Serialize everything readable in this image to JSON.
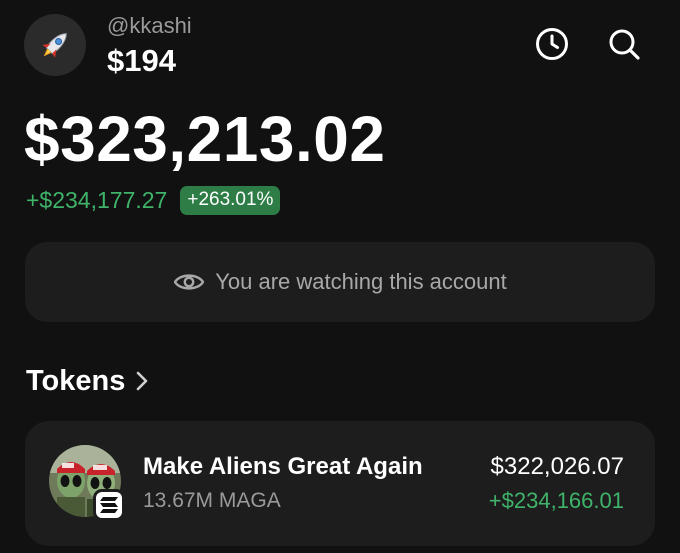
{
  "profile": {
    "avatar_icon": "rocket-icon",
    "username": "@kkashi",
    "small_balance": "$194"
  },
  "header_actions": {
    "history_icon": "clock-icon",
    "search_icon": "search-icon"
  },
  "portfolio": {
    "balance": "$323,213.02",
    "change_amount": "+$234,177.27",
    "change_percent": "+263.01%"
  },
  "watch_banner": {
    "icon": "eye-icon",
    "text": "You are watching this account"
  },
  "tokens_section": {
    "title": "Tokens",
    "chevron_icon": "chevron-right-icon",
    "items": [
      {
        "name": "Make Aliens Great Again",
        "amount": "13.67M MAGA",
        "value": "$322,026.07",
        "change": "+$234,166.01",
        "avatar_icon": "alien-token-icon",
        "chain_icon": "solana-icon"
      }
    ]
  },
  "colors": {
    "background": "#111111",
    "card": "#1d1d1d",
    "positive": "#3fb36a",
    "positive_badge": "#2e7d46",
    "muted_text": "#9a9a9a"
  }
}
